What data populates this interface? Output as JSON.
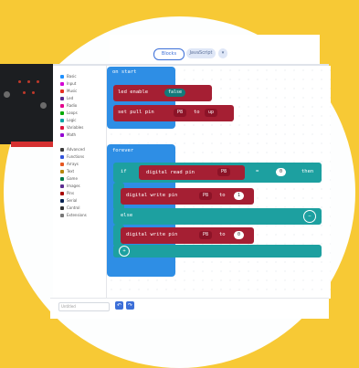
{
  "header": {
    "tab_blocks": "Blocks",
    "tab_js": "JavaScript",
    "dropdown": "▾"
  },
  "toolbox": {
    "items": [
      {
        "label": "Basic",
        "color": "#1E90FF"
      },
      {
        "label": "Input",
        "color": "#D400D4"
      },
      {
        "label": "Music",
        "color": "#E63022"
      },
      {
        "label": "Led",
        "color": "#5C2D91"
      },
      {
        "label": "Radio",
        "color": "#E3008C"
      },
      {
        "label": "Loops",
        "color": "#00AA00"
      },
      {
        "label": "Logic",
        "color": "#00A4A6"
      },
      {
        "label": "Variables",
        "color": "#DC143C"
      },
      {
        "label": "Math",
        "color": "#9400D3"
      },
      {
        "label": "Advanced",
        "color": "#3C3C3C"
      },
      {
        "label": "Functions",
        "color": "#3455DB"
      },
      {
        "label": "Arrays",
        "color": "#E65722"
      },
      {
        "label": "Text",
        "color": "#B8860B"
      },
      {
        "label": "Game",
        "color": "#007A4B"
      },
      {
        "label": "Images",
        "color": "#5C2D91"
      },
      {
        "label": "Pins",
        "color": "#A80000"
      },
      {
        "label": "Serial",
        "color": "#002050"
      },
      {
        "label": "Control",
        "color": "#333333"
      },
      {
        "label": "Extensions",
        "color": "#777777"
      }
    ]
  },
  "on_start": {
    "label": "on start",
    "led_enable": "led enable",
    "led_value": "false",
    "set_pull": "set pull pin",
    "set_pull_pin": "P8",
    "set_pull_to": "to",
    "set_pull_mode": "up"
  },
  "forever": {
    "label": "forever",
    "if": "if",
    "digital_read": "digital read pin",
    "read_pin": "P8",
    "operator": "=",
    "compare_value": "0",
    "then": "then",
    "write1": "digital write pin",
    "write1_pin": "P8",
    "write1_to": "to",
    "write1_value": "1",
    "else": "else",
    "write2": "digital write pin",
    "write2_pin": "P8",
    "write2_to": "to",
    "write2_value": "0"
  },
  "footer": {
    "project_name_placeholder": "Untitled",
    "undo": "↶",
    "redo": "↷"
  }
}
